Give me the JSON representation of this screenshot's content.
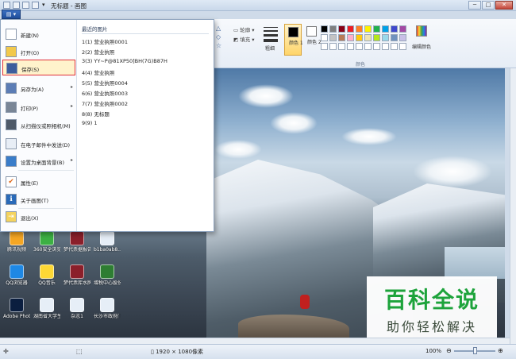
{
  "window": {
    "title": "无标题 - 画图",
    "minimize": "─",
    "maximize": "□",
    "close": "✕"
  },
  "app_button": {
    "label": "▤ ▾"
  },
  "quick_access": [
    "save-icon",
    "undo-icon",
    "redo-icon",
    "dropdown-icon"
  ],
  "ribbon": {
    "outline_label": "轮廓",
    "fill_label": "填充",
    "size_label": "粗细",
    "color1_label": "颜色 1",
    "color2_label": "颜色 2",
    "colors_group": "颜色",
    "edit_colors": "编辑颜色",
    "palette_row1": [
      "#000000",
      "#7f7f7f",
      "#880015",
      "#ed1c24",
      "#ff7f27",
      "#fff200",
      "#22b14c",
      "#00a2e8",
      "#3f48cc",
      "#a349a4"
    ],
    "palette_row2": [
      "#ffffff",
      "#c3c3c3",
      "#b97a57",
      "#ffaec9",
      "#ffc90e",
      "#efe4b0",
      "#b5e61d",
      "#99d9ea",
      "#7092be",
      "#c8bfe7"
    ]
  },
  "menu": {
    "items": [
      {
        "label": "新建(N)",
        "icon": "new-icon",
        "arrow": ""
      },
      {
        "label": "打开(O)",
        "icon": "open-icon",
        "arrow": ""
      },
      {
        "label": "保存(S)",
        "icon": "save-icon",
        "arrow": ""
      },
      {
        "label": "另存为(A)",
        "icon": "save-as-icon",
        "arrow": "▸"
      },
      {
        "label": "打印(P)",
        "icon": "print-icon",
        "arrow": "▸"
      },
      {
        "label": "从扫描仪或照相机(M)",
        "icon": "scanner-icon",
        "arrow": ""
      },
      {
        "label": "在电子邮件中发送(D)",
        "icon": "email-icon",
        "arrow": ""
      },
      {
        "label": "设置为桌面背景(B)",
        "icon": "desktop-icon",
        "arrow": "▸"
      },
      {
        "label": "属性(E)",
        "icon": "properties-icon",
        "arrow": ""
      },
      {
        "label": "关于画图(T)",
        "icon": "about-icon",
        "arrow": ""
      },
      {
        "label": "退出(X)",
        "icon": "exit-icon",
        "arrow": ""
      }
    ],
    "recent_title": "最近的图片",
    "recent": [
      "1(1)  营业执照0001",
      "2(2)  营业执照",
      "3(3)  YY~P@81XP50]BH(7G)B87H",
      "4(4)  营业执照",
      "5(5)  营业执照0004",
      "6(6)  营业执照0003",
      "7(7)  营业执照0002",
      "8(8)  无标题",
      "9(9)  1"
    ]
  },
  "desktop_icons": [
    {
      "label": "腾讯视频",
      "color": "#f5a623"
    },
    {
      "label": "360安全浏览器",
      "color": "#3cb043"
    },
    {
      "label": "梦代票据报告件",
      "color": "#8b1f2a"
    },
    {
      "label": "b1ba0ab8...",
      "color": "#e6eef7"
    },
    {
      "label": "QQ浏览器",
      "color": "#1e88e5"
    },
    {
      "label": "QQ音乐",
      "color": "#fdd835"
    },
    {
      "label": "梦代票库水牌",
      "color": "#8b1f2a"
    },
    {
      "label": "增税中心股份赛图片",
      "color": "#2e7d32"
    },
    {
      "label": "Adobe Photosh...",
      "color": "#0b1e3f"
    },
    {
      "label": "湖南省大学生物研...",
      "color": "#e6eef7"
    },
    {
      "label": "杂志1",
      "color": "#e6eef7"
    },
    {
      "label": "长沙市政府门户网站...",
      "color": "#e6eef7"
    }
  ],
  "watermark": {
    "main": "百科全说",
    "sub": "助你轻松解决"
  },
  "statusbar": {
    "dimensions": "1920 × 1080像素",
    "zoom": "100%",
    "zoom_level": 0.5
  }
}
